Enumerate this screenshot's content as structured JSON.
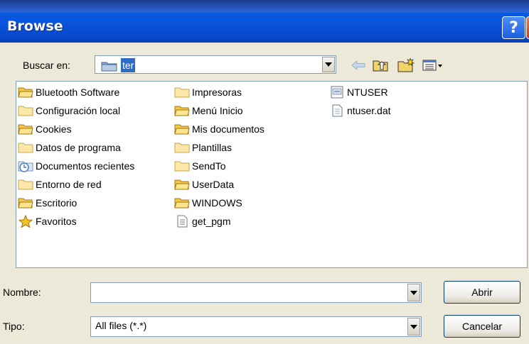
{
  "window": {
    "title": "Browse"
  },
  "titlebar": {
    "help_label": "?",
    "close_label": "✕"
  },
  "lookin": {
    "label": "Buscar en:",
    "value": "ter"
  },
  "files": [
    {
      "name": "Bluetooth Software",
      "icon": "folder-open-icon"
    },
    {
      "name": "Configuración local",
      "icon": "folder-icon"
    },
    {
      "name": "Cookies",
      "icon": "folder-open-icon"
    },
    {
      "name": "Datos de programa",
      "icon": "folder-icon"
    },
    {
      "name": "Documentos recientes",
      "icon": "recent-documents-icon"
    },
    {
      "name": "Entorno de red",
      "icon": "folder-icon"
    },
    {
      "name": "Escritorio",
      "icon": "folder-open-icon"
    },
    {
      "name": "Favoritos",
      "icon": "favorites-star-icon"
    },
    {
      "name": "Impresoras",
      "icon": "folder-icon"
    },
    {
      "name": "Menú Inicio",
      "icon": "folder-open-icon"
    },
    {
      "name": "Mis documentos",
      "icon": "folder-open-icon"
    },
    {
      "name": "Plantillas",
      "icon": "folder-icon"
    },
    {
      "name": "SendTo",
      "icon": "folder-icon"
    },
    {
      "name": "UserData",
      "icon": "folder-open-icon"
    },
    {
      "name": "WINDOWS",
      "icon": "folder-open-icon"
    },
    {
      "name": "get_pgm",
      "icon": "file-icon"
    },
    {
      "name": "NTUSER",
      "icon": "registry-file-icon"
    },
    {
      "name": "ntuser.dat",
      "icon": "file-icon"
    }
  ],
  "filename": {
    "label": "Nombre:",
    "value": ""
  },
  "filetype": {
    "label": "Tipo:",
    "value": "All files (*.*)"
  },
  "buttons": {
    "open": "Abrir",
    "cancel": "Cancelar"
  },
  "colors": {
    "title_bar": "#0855dd",
    "selection": "#316ac5",
    "folder": "#f5d36b",
    "dialog_bg": "#ece9d8"
  }
}
